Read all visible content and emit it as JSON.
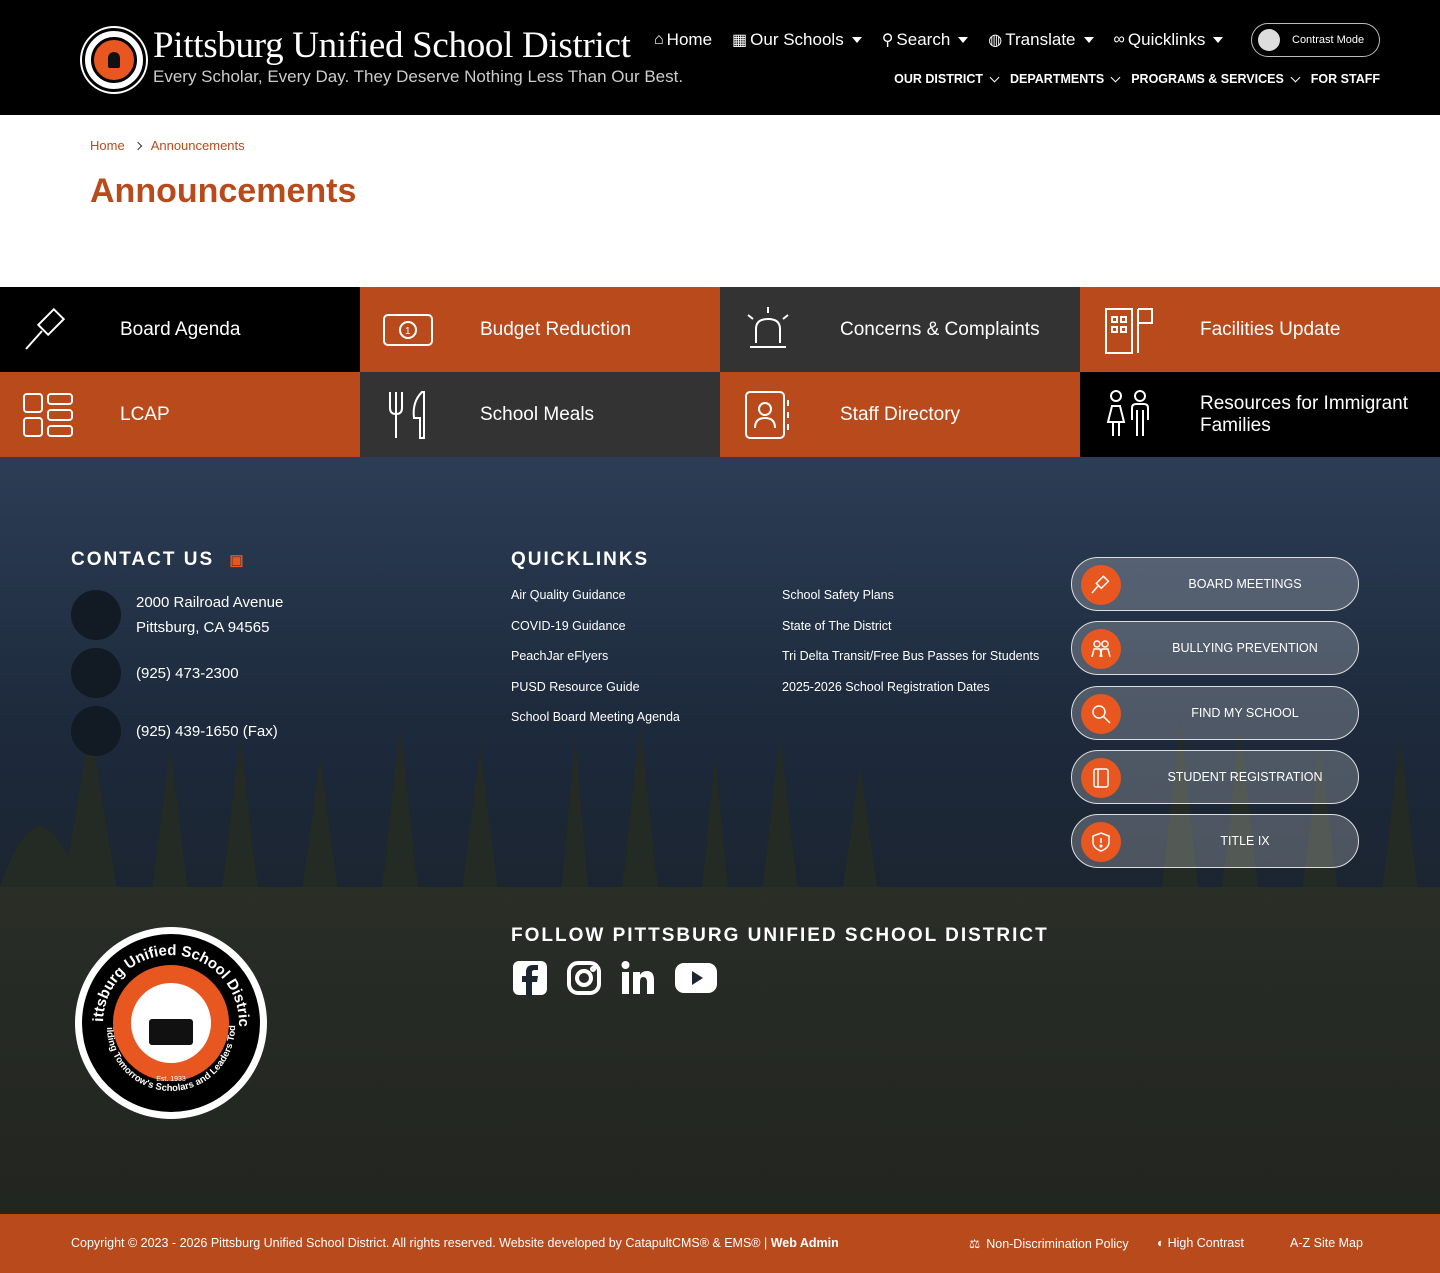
{
  "header": {
    "title": "Pittsburg Unified School District",
    "tagline": "Every Scholar, Every Day. They Deserve Nothing Less Than Our Best.",
    "top_nav": [
      {
        "label": "Home",
        "icon": "home-icon"
      },
      {
        "label": "Our Schools",
        "icon": "school-icon"
      },
      {
        "label": "Search",
        "icon": "search-icon"
      },
      {
        "label": "Translate",
        "icon": "globe-icon"
      },
      {
        "label": "Quicklinks",
        "icon": "link-icon"
      }
    ],
    "contrast_mode": "Contrast Mode",
    "main_nav": [
      "OUR DISTRICT",
      "DEPARTMENTS",
      "PROGRAMS & SERVICES",
      "FOR STAFF"
    ]
  },
  "breadcrumb": {
    "home": "Home",
    "current": "Announcements"
  },
  "page_title": "Announcements",
  "tiles": [
    {
      "label": "Board Agenda",
      "icon": "gavel-icon",
      "bg": "#000000"
    },
    {
      "label": "Budget Reduction",
      "icon": "money-icon",
      "bg": "#b84a1c"
    },
    {
      "label": "Concerns & Complaints",
      "icon": "siren-icon",
      "bg": "#333333"
    },
    {
      "label": "Facilities Update",
      "icon": "building-icon",
      "bg": "#b84a1c"
    },
    {
      "label": "LCAP",
      "icon": "grid-icon",
      "bg": "#b84a1c"
    },
    {
      "label": "School Meals",
      "icon": "utensils-icon",
      "bg": "#333333"
    },
    {
      "label": "Staff Directory",
      "icon": "contact-book-icon",
      "bg": "#b84a1c"
    },
    {
      "label": "Resources for Immigrant Families",
      "icon": "family-icon",
      "bg": "#000000"
    }
  ],
  "contact": {
    "heading": "CONTACT US",
    "address_line1": "2000 Railroad Avenue",
    "address_line2": "Pittsburg, CA 94565",
    "phone": "(925) 473-2300",
    "fax": "(925) 439-1650 (Fax)"
  },
  "quicklinks": {
    "heading": "QUICKLINKS",
    "col1": [
      "Air Quality Guidance",
      "COVID-19 Guidance",
      "PeachJar eFlyers",
      "PUSD Resource Guide",
      "School Board Meeting Agenda"
    ],
    "col2": [
      "School Safety Plans",
      "State of The District",
      "Tri Delta Transit/Free Bus Passes for Students",
      "2025-2026 School Registration Dates"
    ]
  },
  "quick_buttons": [
    {
      "label": "BOARD MEETINGS",
      "icon": "gavel-icon"
    },
    {
      "label": "BULLYING PREVENTION",
      "icon": "people-icon"
    },
    {
      "label": "FIND MY SCHOOL",
      "icon": "magnifier-icon"
    },
    {
      "label": "STUDENT REGISTRATION",
      "icon": "notebook-icon"
    },
    {
      "label": "TITLE IX",
      "icon": "shield-icon"
    }
  ],
  "follow": {
    "heading": "FOLLOW PITTSBURG UNIFIED SCHOOL DISTRICT",
    "networks": [
      "facebook-icon",
      "instagram-icon",
      "linkedin-icon",
      "youtube-icon"
    ]
  },
  "seal": {
    "arc_text": "Pittsburg Unified School District",
    "bottom_text": "Building Tomorrow's Scholars and Leaders Today",
    "est": "Est. 1933"
  },
  "bottom": {
    "copyright": "Copyright © 2023 - 2026 Pittsburg Unified School District. All rights reserved. Website developed by CatapultCMS® & EMS® | ",
    "web_admin": "Web Admin",
    "non_discrimination": "Non-Discrimination Policy",
    "high_contrast": "High Contrast",
    "sitemap": "A-Z Site Map"
  },
  "colors": {
    "accent": "#b84a1c",
    "orange": "#e8571f",
    "dark": "#333333",
    "black": "#000000"
  }
}
